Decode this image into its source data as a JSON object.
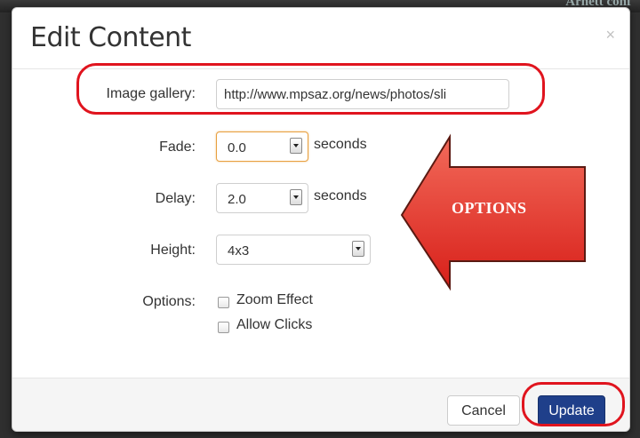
{
  "backdrop": {
    "text": "Arnett conf"
  },
  "dialog": {
    "title": "Edit Content",
    "close_glyph": "×"
  },
  "form": {
    "image_gallery": {
      "label": "Image gallery:",
      "value": "http://www.mpsaz.org/news/photos/sli"
    },
    "fade": {
      "label": "Fade:",
      "value": "0.0",
      "unit": "seconds"
    },
    "delay": {
      "label": "Delay:",
      "value": "2.0",
      "unit": "seconds"
    },
    "height": {
      "label": "Height:",
      "value": "4x3"
    },
    "options": {
      "label": "Options:",
      "items": [
        {
          "label": "Zoom Effect",
          "checked": false
        },
        {
          "label": "Allow Clicks",
          "checked": false
        }
      ]
    }
  },
  "footer": {
    "cancel_label": "Cancel",
    "update_label": "Update"
  },
  "annotation": {
    "arrow_text": "OPTIONS",
    "arrow_color": "#e8403a",
    "ring_color": "#e0141e"
  },
  "colors": {
    "primary_button": "#1f3f8a",
    "focus_border": "#e8a040"
  }
}
